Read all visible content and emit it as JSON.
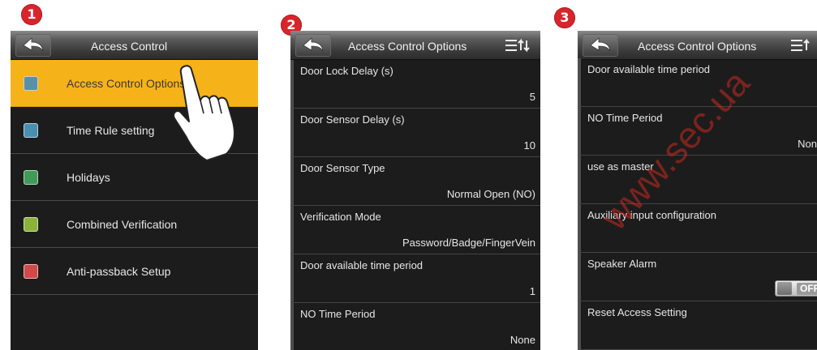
{
  "steps": [
    "1",
    "2",
    "3"
  ],
  "screen1": {
    "title": "Access Control",
    "items": [
      {
        "label": "Access Control Options",
        "icon": "door-options-icon",
        "selected": true
      },
      {
        "label": "Time Rule setting",
        "icon": "clock-gear-icon"
      },
      {
        "label": "Holidays",
        "icon": "calendar-icon"
      },
      {
        "label": "Combined Verification",
        "icon": "combined-verification-icon"
      },
      {
        "label": "Anti-passback Setup",
        "icon": "anti-passback-icon"
      }
    ]
  },
  "screen2": {
    "title": "Access Control Options",
    "options": [
      {
        "label": "Door Lock Delay (s)",
        "value": "5"
      },
      {
        "label": "Door Sensor Delay (s)",
        "value": "10"
      },
      {
        "label": "Door Sensor Type",
        "value": "Normal Open (NO)"
      },
      {
        "label": "Verification Mode",
        "value": "Password/Badge/FingerVein"
      },
      {
        "label": "Door available time period",
        "value": "1"
      },
      {
        "label": "NO Time Period",
        "value": "None"
      }
    ]
  },
  "screen3": {
    "title": "Access Control Options",
    "options": [
      {
        "label": "Door available time period",
        "value": ""
      },
      {
        "label": "NO Time Period",
        "value": "Non"
      },
      {
        "label": "use as master",
        "value": ""
      },
      {
        "label": "Auxiliary input configuration",
        "value": ""
      },
      {
        "label": "Speaker Alarm",
        "value": "OFF"
      },
      {
        "label": "Reset Access Setting",
        "value": ""
      }
    ]
  },
  "watermark": "www.sec.ua",
  "colors": {
    "badge": "#d7262b",
    "selected": "#f6b219",
    "screen_bg": "#1c1c1c",
    "watermark": "#c92a20"
  }
}
